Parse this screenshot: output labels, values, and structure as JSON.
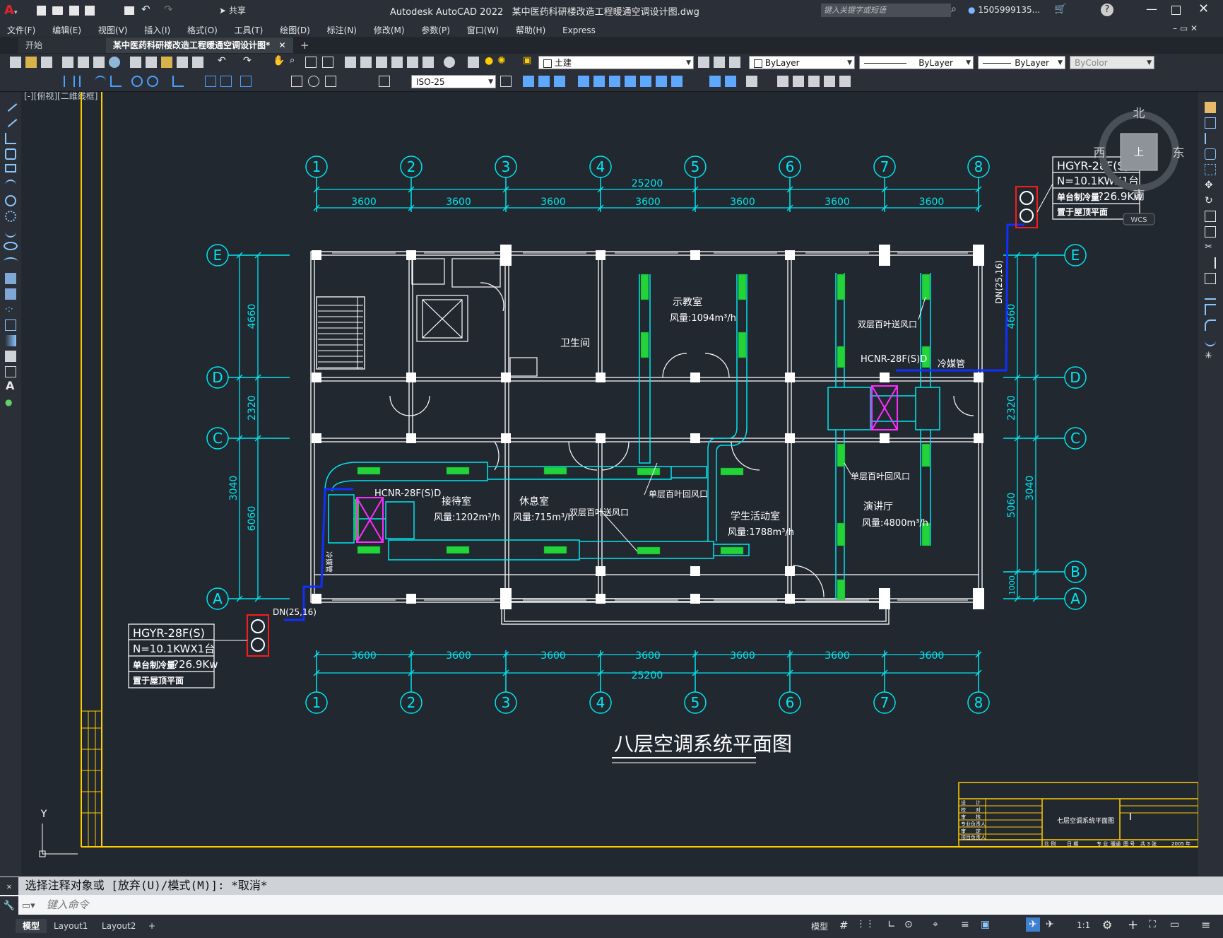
{
  "titlebar": {
    "app_title": "Autodesk AutoCAD 2022",
    "file_title": "某中医药科研楼改造工程暖通空调设计图.dwg",
    "share_label": "共享",
    "search_placeholder": "键入关键字或短语",
    "user": "1505999135...",
    "colors": {
      "bg": "#2b3038",
      "logo": "#d9262c"
    }
  },
  "menu": [
    "文件(F)",
    "编辑(E)",
    "视图(V)",
    "插入(I)",
    "格式(O)",
    "工具(T)",
    "绘图(D)",
    "标注(N)",
    "修改(M)",
    "参数(P)",
    "窗口(W)",
    "帮助(H)",
    "Express"
  ],
  "tabs": {
    "start": "开始",
    "active": "某中医药科研楼改造工程暖通空调设计图*",
    "add": "+"
  },
  "toolbar": {
    "layer": "土建",
    "color": "ByLayer",
    "linetype": "ByLayer",
    "lineweight": "ByLayer",
    "plotstyle": "ByColor",
    "dimstyle": "ISO-25"
  },
  "viewport_label": "[-][俯视][二维线框]",
  "viewcube": {
    "north": "北",
    "south": "南",
    "east": "东",
    "west": "西",
    "top": "上",
    "wcs": "WCS"
  },
  "drawing": {
    "title": "八层空调系统平面图",
    "overall": "25200",
    "spans": [
      "3600",
      "3600",
      "3600",
      "3600",
      "3600",
      "3600",
      "3600"
    ],
    "col_axes": [
      "1",
      "2",
      "3",
      "4",
      "5",
      "6",
      "7",
      "8"
    ],
    "row_axes": [
      "E",
      "D",
      "C",
      "B",
      "A"
    ],
    "left_dims": [
      "4660",
      "2320",
      "3040",
      "6060"
    ],
    "right_dims": [
      "4660",
      "2320",
      "3040",
      "5060",
      "1000"
    ],
    "rooms": {
      "toilet": "卫生间",
      "classroom": "示教室",
      "classroom_air": "风量:1094m³/h",
      "reception": "接待室",
      "reception_air": "风量:1202m³/h",
      "lounge": "休息室",
      "lounge_air": "风量:715m³/h",
      "activity": "学生活动室",
      "activity_air": "风量:1788m³/h",
      "lecture": "演讲厅",
      "lecture_air": "风量:4800m³/h"
    },
    "labels": {
      "ahu_left": "HCNR-28F(S)D",
      "ahu_right": "HCNR-28F(S)D",
      "double_supply": "双层百叶送风口",
      "double_supply_2": "双层百叶送风口",
      "single_return": "单层百叶回风口",
      "single_return_2": "单层百叶回风口",
      "refrigerant_pipe": "冷媒管",
      "refrigerant_pipe_left": "冷媒管",
      "dn": "DN(25,16)",
      "dn_right": "DN(25,16)"
    },
    "outdoor_unit": {
      "model": "HGYR-28F(S)",
      "capacity": "N=10.1KWX1台",
      "cooling_label": "单台制冷量",
      "cooling_value": "?26.9Kw",
      "location": "置于屋顶平面"
    },
    "titleblock": {
      "name": "七层空调系统平面图",
      "rows": [
        "设　　计",
        "校　　对",
        "审　　核",
        "专业负责人",
        "审　　定",
        "项目负责人"
      ],
      "bottom": [
        "比 例",
        "日 期",
        "专 业",
        "暖通",
        "图 号",
        "共 3 张",
        "2005 年"
      ]
    },
    "ucs": {
      "y": "Y"
    },
    "colors": {
      "cyan": "#00e5ef",
      "white": "#ffffff",
      "green": "#22d43a",
      "magenta": "#ff2bff",
      "blue": "#1030ff",
      "red": "#ff1a1a",
      "yellow": "#ffcc00"
    }
  },
  "command": {
    "history": "选择注释对象或 [放弃(U)/模式(M)]: *取消*",
    "placeholder": "键入命令"
  },
  "layouts": [
    "模型",
    "Layout1",
    "Layout2"
  ],
  "status": {
    "model": "模型",
    "scale": "1:1"
  }
}
